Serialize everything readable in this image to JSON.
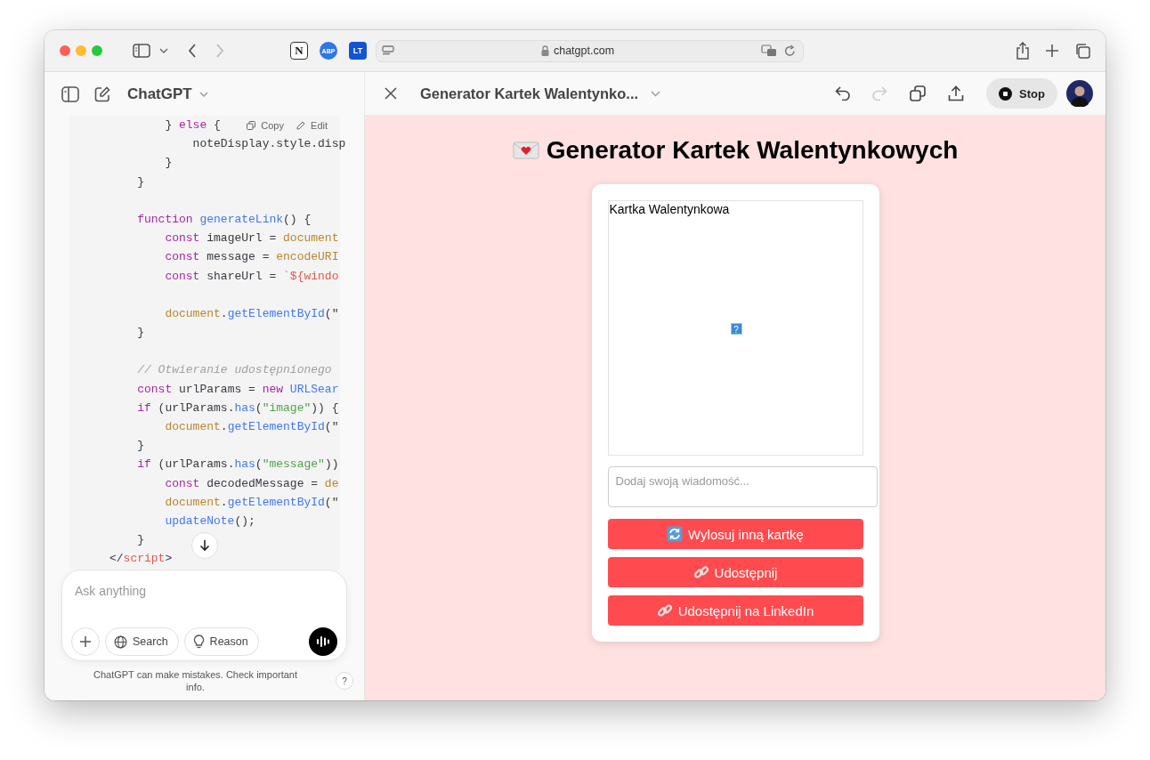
{
  "browser": {
    "back": {
      "disabled": false
    },
    "forward": {
      "disabled": true
    },
    "extensions": [
      {
        "kind": "notion",
        "label": "N"
      },
      {
        "kind": "abp",
        "label": "ABP"
      },
      {
        "kind": "lt",
        "label": "LT"
      }
    ],
    "url": "chatgpt.com"
  },
  "chat_panel": {
    "title": "ChatGPT",
    "code_actions": [
      {
        "kind": "copy",
        "label": "Copy"
      },
      {
        "kind": "edit",
        "label": "Edit"
      }
    ],
    "code_lines": [
      {
        "blank_line_before": false,
        "tokens": [
          {
            "kind": "plain",
            "text": "        } "
          },
          {
            "kind": "keyword",
            "text": "else"
          },
          {
            "kind": "plain",
            "text": " {"
          }
        ]
      },
      {
        "blank_line_before": false,
        "tokens": [
          {
            "kind": "plain",
            "text": "            noteDisplay.style.disp"
          }
        ]
      },
      {
        "blank_line_before": false,
        "tokens": [
          {
            "kind": "plain",
            "text": "        }"
          }
        ]
      },
      {
        "blank_line_before": false,
        "tokens": [
          {
            "kind": "plain",
            "text": "    }"
          }
        ]
      },
      {
        "blank_line_before": true,
        "tokens": [
          {
            "kind": "keyword",
            "text": "    function "
          },
          {
            "kind": "function",
            "text": "generateLink"
          },
          {
            "kind": "plain",
            "text": "() {"
          }
        ]
      },
      {
        "blank_line_before": false,
        "tokens": [
          {
            "kind": "keyword",
            "text": "        const"
          },
          {
            "kind": "plain",
            "text": " imageUrl = "
          },
          {
            "kind": "object",
            "text": "document"
          }
        ]
      },
      {
        "blank_line_before": false,
        "tokens": [
          {
            "kind": "keyword",
            "text": "        const"
          },
          {
            "kind": "plain",
            "text": " message = "
          },
          {
            "kind": "object",
            "text": "encodeURI"
          }
        ]
      },
      {
        "blank_line_before": false,
        "tokens": [
          {
            "kind": "keyword",
            "text": "        const"
          },
          {
            "kind": "plain",
            "text": " shareUrl = "
          },
          {
            "kind": "template",
            "text": "`${windo"
          }
        ]
      },
      {
        "blank_line_before": true,
        "tokens": [
          {
            "kind": "object",
            "text": "        document"
          },
          {
            "kind": "plain",
            "text": "."
          },
          {
            "kind": "function",
            "text": "getElementById"
          },
          {
            "kind": "plain",
            "text": "(\""
          }
        ]
      },
      {
        "blank_line_before": false,
        "tokens": [
          {
            "kind": "plain",
            "text": "    }"
          }
        ]
      },
      {
        "blank_line_before": true,
        "tokens": [
          {
            "kind": "comment",
            "text": "    // Otwieranie udostępnionego"
          }
        ]
      },
      {
        "blank_line_before": false,
        "tokens": [
          {
            "kind": "keyword",
            "text": "    const"
          },
          {
            "kind": "plain",
            "text": " urlParams = "
          },
          {
            "kind": "keyword",
            "text": "new "
          },
          {
            "kind": "function",
            "text": "URLSear"
          }
        ]
      },
      {
        "blank_line_before": false,
        "tokens": [
          {
            "kind": "keyword",
            "text": "    if"
          },
          {
            "kind": "plain",
            "text": " (urlParams."
          },
          {
            "kind": "function",
            "text": "has"
          },
          {
            "kind": "plain",
            "text": "("
          },
          {
            "kind": "string",
            "text": "\"image\""
          },
          {
            "kind": "plain",
            "text": ")) {"
          }
        ]
      },
      {
        "blank_line_before": false,
        "tokens": [
          {
            "kind": "object",
            "text": "        document"
          },
          {
            "kind": "plain",
            "text": "."
          },
          {
            "kind": "function",
            "text": "getElementById"
          },
          {
            "kind": "plain",
            "text": "(\""
          }
        ]
      },
      {
        "blank_line_before": false,
        "tokens": [
          {
            "kind": "plain",
            "text": "    }"
          }
        ]
      },
      {
        "blank_line_before": false,
        "tokens": [
          {
            "kind": "keyword",
            "text": "    if"
          },
          {
            "kind": "plain",
            "text": " (urlParams."
          },
          {
            "kind": "function",
            "text": "has"
          },
          {
            "kind": "plain",
            "text": "("
          },
          {
            "kind": "string",
            "text": "\"message\""
          },
          {
            "kind": "plain",
            "text": "))"
          }
        ]
      },
      {
        "blank_line_before": false,
        "tokens": [
          {
            "kind": "keyword",
            "text": "        const"
          },
          {
            "kind": "plain",
            "text": " decodedMessage = "
          },
          {
            "kind": "object",
            "text": "de"
          }
        ]
      },
      {
        "blank_line_before": false,
        "tokens": [
          {
            "kind": "object",
            "text": "        document"
          },
          {
            "kind": "plain",
            "text": "."
          },
          {
            "kind": "function",
            "text": "getElementById"
          },
          {
            "kind": "plain",
            "text": "(\""
          }
        ]
      },
      {
        "blank_line_before": false,
        "tokens": [
          {
            "kind": "function",
            "text": "        updateNote"
          },
          {
            "kind": "plain",
            "text": "();"
          }
        ]
      },
      {
        "blank_line_before": false,
        "tokens": [
          {
            "kind": "plain",
            "text": "    }"
          }
        ]
      },
      {
        "blank_line_before": false,
        "tokens": [
          {
            "kind": "plain",
            "text": "</"
          },
          {
            "kind": "tag",
            "text": "script"
          },
          {
            "kind": "plain",
            "text": ">"
          }
        ]
      }
    ],
    "composer": {
      "placeholder": "Ask anything",
      "tools": [
        {
          "kind": "globe",
          "label": "Search"
        },
        {
          "kind": "bulb",
          "label": "Reason"
        }
      ]
    },
    "disclaimer": "ChatGPT can make mistakes. Check important info.",
    "help": "?"
  },
  "canvas": {
    "title": "Generator Kartek Walentynko...",
    "redo_disabled": true,
    "stop_label": "Stop"
  },
  "page": {
    "heading": "Generator Kartek Walentynkowych",
    "image_alt": "Kartka Walentynkowa",
    "broken_mark": "?",
    "message_placeholder": "Dodaj swoją wiadomość...",
    "buttons": [
      {
        "kind": "refresh",
        "label": "Wylosuj inną kartkę"
      },
      {
        "kind": "link",
        "label": "Udostępnij"
      },
      {
        "kind": "link",
        "label": "Udostępnij na LinkedIn"
      }
    ]
  }
}
